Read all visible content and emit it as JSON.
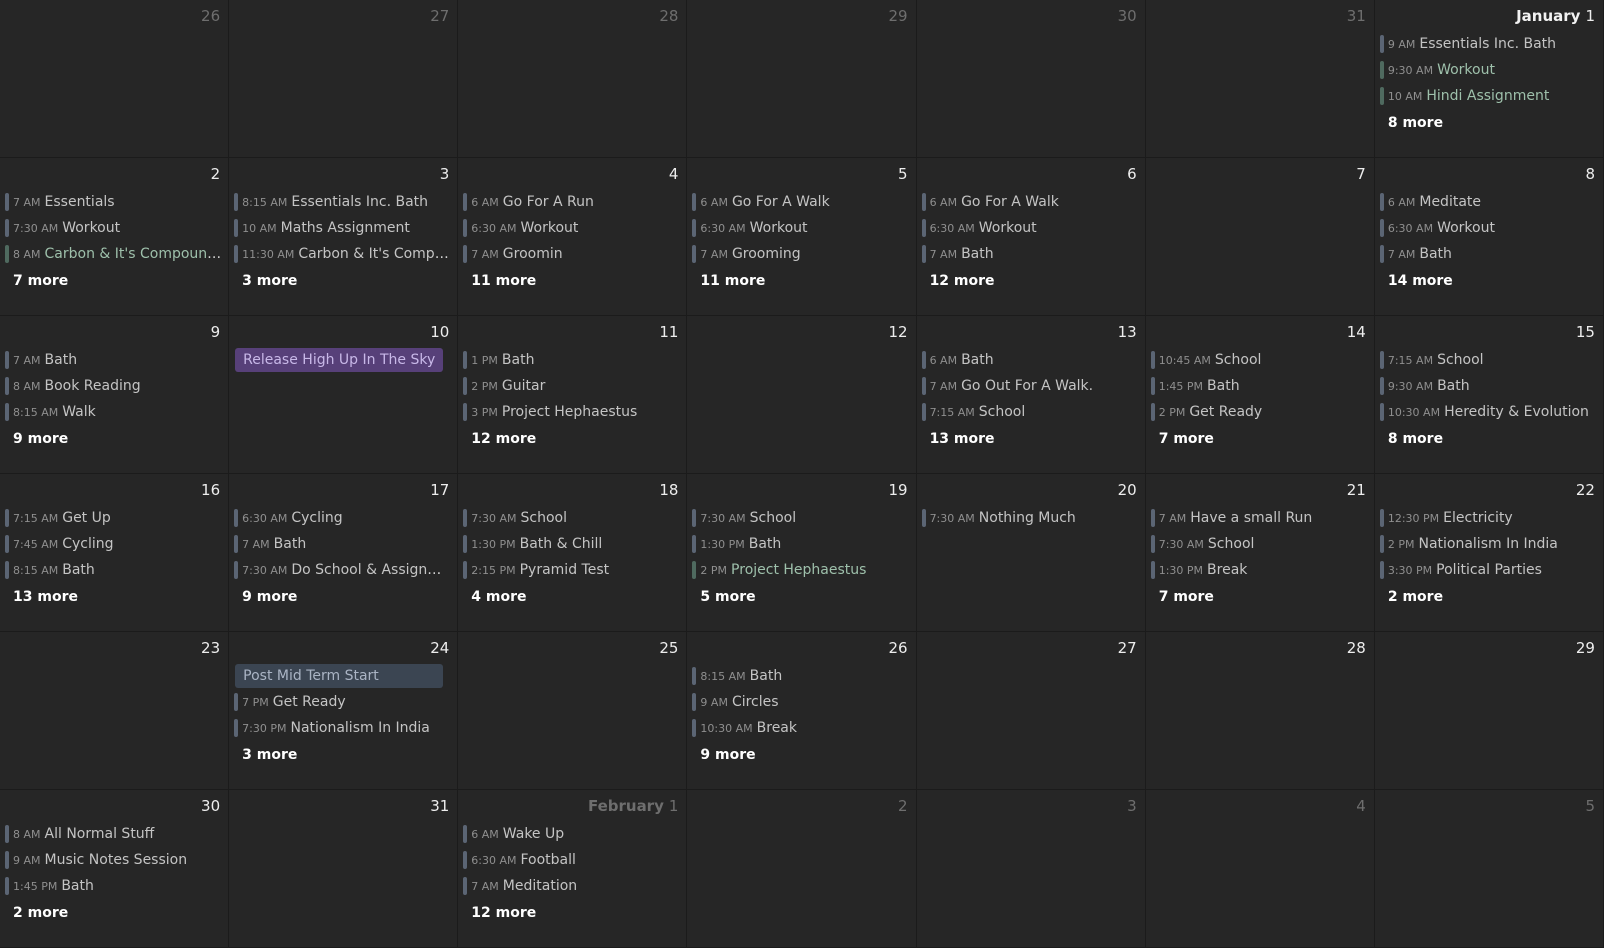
{
  "weeks": [
    [
      {
        "day": "26",
        "other": true,
        "events": []
      },
      {
        "day": "27",
        "other": true,
        "events": []
      },
      {
        "day": "28",
        "other": true,
        "events": []
      },
      {
        "day": "29",
        "other": true,
        "events": []
      },
      {
        "day": "30",
        "other": true,
        "events": []
      },
      {
        "day": "31",
        "other": true,
        "events": []
      },
      {
        "day": "1",
        "month": "January",
        "events": [
          {
            "time": "9 AM",
            "title": "Essentials Inc. Bath"
          },
          {
            "time": "9:30 AM",
            "title": "Workout",
            "color": "green"
          },
          {
            "time": "10 AM",
            "title": "Hindi Assignment",
            "color": "green"
          }
        ],
        "more": "8 more"
      }
    ],
    [
      {
        "day": "2",
        "events": [
          {
            "time": "7 AM",
            "title": "Essentials"
          },
          {
            "time": "7:30 AM",
            "title": "Workout"
          },
          {
            "time": "8 AM",
            "title": "Carbon & It's Compounds",
            "color": "green"
          }
        ],
        "more": "7 more"
      },
      {
        "day": "3",
        "events": [
          {
            "time": "8:15 AM",
            "title": "Essentials Inc. Bath"
          },
          {
            "time": "10 AM",
            "title": "Maths Assignment"
          },
          {
            "time": "11:30 AM",
            "title": "Carbon & It's Compo..."
          }
        ],
        "more": "3 more"
      },
      {
        "day": "4",
        "events": [
          {
            "time": "6 AM",
            "title": "Go For A Run"
          },
          {
            "time": "6:30 AM",
            "title": "Workout"
          },
          {
            "time": "7 AM",
            "title": "Groomin"
          }
        ],
        "more": "11 more"
      },
      {
        "day": "5",
        "events": [
          {
            "time": "6 AM",
            "title": "Go For A Walk"
          },
          {
            "time": "6:30 AM",
            "title": "Workout"
          },
          {
            "time": "7 AM",
            "title": "Grooming"
          }
        ],
        "more": "11 more"
      },
      {
        "day": "6",
        "events": [
          {
            "time": "6 AM",
            "title": "Go For A Walk"
          },
          {
            "time": "6:30 AM",
            "title": "Workout"
          },
          {
            "time": "7 AM",
            "title": "Bath"
          }
        ],
        "more": "12 more"
      },
      {
        "day": "7",
        "events": []
      },
      {
        "day": "8",
        "events": [
          {
            "time": "6 AM",
            "title": "Meditate"
          },
          {
            "time": "6:30 AM",
            "title": "Workout"
          },
          {
            "time": "7 AM",
            "title": "Bath"
          }
        ],
        "more": "14 more"
      }
    ],
    [
      {
        "day": "9",
        "events": [
          {
            "time": "7 AM",
            "title": "Bath"
          },
          {
            "time": "8 AM",
            "title": "Book Reading"
          },
          {
            "time": "8:15 AM",
            "title": "Walk"
          }
        ],
        "more": "9 more"
      },
      {
        "day": "10",
        "events": [
          {
            "time": "",
            "title": "Release High Up In The Sky",
            "allday": true,
            "color": "purple"
          }
        ]
      },
      {
        "day": "11",
        "events": [
          {
            "time": "1 PM",
            "title": "Bath"
          },
          {
            "time": "2 PM",
            "title": "Guitar"
          },
          {
            "time": "3 PM",
            "title": "Project Hephaestus"
          }
        ],
        "more": "12 more"
      },
      {
        "day": "12",
        "events": []
      },
      {
        "day": "13",
        "events": [
          {
            "time": "6 AM",
            "title": "Bath"
          },
          {
            "time": "7 AM",
            "title": "Go Out For A Walk."
          },
          {
            "time": "7:15 AM",
            "title": "School"
          }
        ],
        "more": "13 more"
      },
      {
        "day": "14",
        "events": [
          {
            "time": "10:45 AM",
            "title": "School"
          },
          {
            "time": "1:45 PM",
            "title": "Bath"
          },
          {
            "time": "2 PM",
            "title": "Get Ready"
          }
        ],
        "more": "7 more"
      },
      {
        "day": "15",
        "events": [
          {
            "time": "7:15 AM",
            "title": "School"
          },
          {
            "time": "9:30 AM",
            "title": "Bath"
          },
          {
            "time": "10:30 AM",
            "title": "Heredity & Evolution"
          }
        ],
        "more": "8 more"
      }
    ],
    [
      {
        "day": "16",
        "events": [
          {
            "time": "7:15 AM",
            "title": "Get Up"
          },
          {
            "time": "7:45 AM",
            "title": "Cycling"
          },
          {
            "time": "8:15 AM",
            "title": "Bath"
          }
        ],
        "more": "13 more"
      },
      {
        "day": "17",
        "events": [
          {
            "time": "6:30 AM",
            "title": "Cycling"
          },
          {
            "time": "7 AM",
            "title": "Bath"
          },
          {
            "time": "7:30 AM",
            "title": "Do School & Assignm..."
          }
        ],
        "more": "9 more"
      },
      {
        "day": "18",
        "events": [
          {
            "time": "7:30 AM",
            "title": "School"
          },
          {
            "time": "1:30 PM",
            "title": "Bath & Chill"
          },
          {
            "time": "2:15 PM",
            "title": "Pyramid Test"
          }
        ],
        "more": "4 more"
      },
      {
        "day": "19",
        "events": [
          {
            "time": "7:30 AM",
            "title": "School"
          },
          {
            "time": "1:30 PM",
            "title": "Bath"
          },
          {
            "time": "2 PM",
            "title": "Project Hephaestus",
            "color": "green"
          }
        ],
        "more": "5 more"
      },
      {
        "day": "20",
        "events": [
          {
            "time": "7:30 AM",
            "title": "Nothing Much"
          }
        ]
      },
      {
        "day": "21",
        "events": [
          {
            "time": "7 AM",
            "title": "Have a small Run"
          },
          {
            "time": "7:30 AM",
            "title": "School"
          },
          {
            "time": "1:30 PM",
            "title": "Break"
          }
        ],
        "more": "7 more"
      },
      {
        "day": "22",
        "events": [
          {
            "time": "12:30 PM",
            "title": "Electricity"
          },
          {
            "time": "2 PM",
            "title": "Nationalism In India"
          },
          {
            "time": "3:30 PM",
            "title": "Political Parties"
          }
        ],
        "more": "2 more"
      }
    ],
    [
      {
        "day": "23",
        "events": []
      },
      {
        "day": "24",
        "events": [
          {
            "time": "",
            "title": "Post Mid Term Start",
            "allday": true,
            "color": "slate"
          },
          {
            "time": "7 PM",
            "title": "Get Ready"
          },
          {
            "time": "7:30 PM",
            "title": "Nationalism In India"
          }
        ],
        "more": "3 more"
      },
      {
        "day": "25",
        "events": []
      },
      {
        "day": "26",
        "events": [
          {
            "time": "8:15 AM",
            "title": "Bath"
          },
          {
            "time": "9 AM",
            "title": "Circles"
          },
          {
            "time": "10:30 AM",
            "title": "Break"
          }
        ],
        "more": "9 more"
      },
      {
        "day": "27",
        "events": []
      },
      {
        "day": "28",
        "events": []
      },
      {
        "day": "29",
        "events": []
      }
    ],
    [
      {
        "day": "30",
        "events": [
          {
            "time": "8 AM",
            "title": "All Normal Stuff"
          },
          {
            "time": "9 AM",
            "title": "Music Notes Session"
          },
          {
            "time": "1:45 PM",
            "title": "Bath"
          }
        ],
        "more": "2 more"
      },
      {
        "day": "31",
        "events": []
      },
      {
        "day": "1",
        "month": "February",
        "other": true,
        "events": [
          {
            "time": "6 AM",
            "title": "Wake Up"
          },
          {
            "time": "6:30 AM",
            "title": "Football"
          },
          {
            "time": "7 AM",
            "title": "Meditation"
          }
        ],
        "more": "12 more"
      },
      {
        "day": "2",
        "other": true,
        "events": []
      },
      {
        "day": "3",
        "other": true,
        "events": []
      },
      {
        "day": "4",
        "other": true,
        "events": []
      },
      {
        "day": "5",
        "other": true,
        "events": []
      }
    ]
  ]
}
